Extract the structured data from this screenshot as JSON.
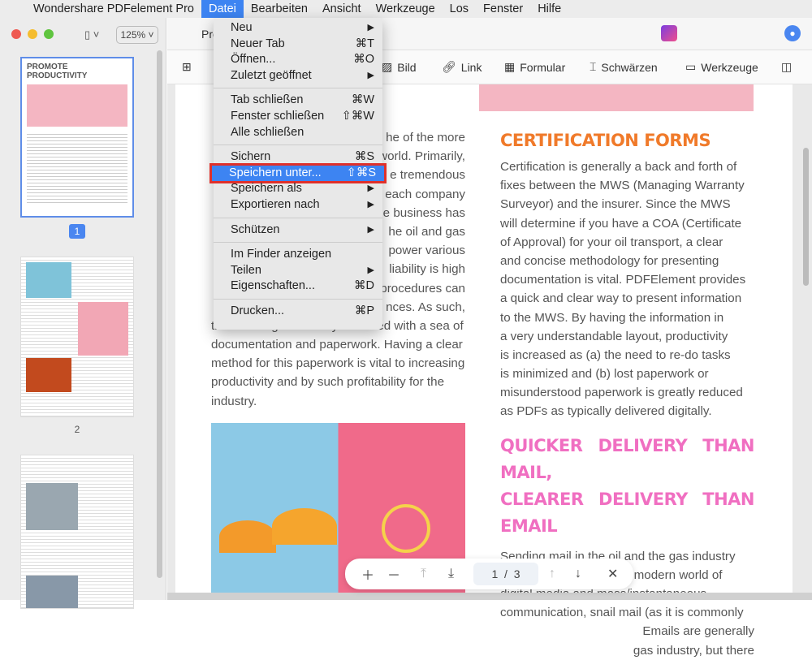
{
  "menubar": {
    "app": "Wondershare PDFelement Pro",
    "items": [
      "Datei",
      "Bearbeiten",
      "Ansicht",
      "Werkzeuge",
      "Los",
      "Fenster",
      "Hilfe"
    ]
  },
  "window": {
    "zoom": "125%",
    "tab": "Pro"
  },
  "toolbar": {
    "items": [
      "Bild",
      "Link",
      "Formular",
      "Schwärzen",
      "Werkzeuge"
    ]
  },
  "sidebar": {
    "thumb1_title": "PROMOTE PRODUCTIVITY",
    "pages": [
      "1",
      "2"
    ]
  },
  "file_menu": {
    "groups": [
      [
        {
          "label": "Neu",
          "shortcut": "▶"
        },
        {
          "label": "Neuer Tab",
          "shortcut": "⌘T"
        },
        {
          "label": "Öffnen...",
          "shortcut": "⌘O"
        },
        {
          "label": "Zuletzt geöffnet",
          "shortcut": "▶"
        }
      ],
      [
        {
          "label": "Tab schließen",
          "shortcut": "⌘W"
        },
        {
          "label": "Fenster schließen",
          "shortcut": "⇧⌘W"
        },
        {
          "label": "Alle schließen",
          "shortcut": ""
        }
      ],
      [
        {
          "label": "Sichern",
          "shortcut": "⌘S"
        },
        {
          "label": "Speichern unter...",
          "shortcut": "⇧⌘S"
        },
        {
          "label": "Speichern als",
          "shortcut": "▶"
        },
        {
          "label": "Exportieren nach",
          "shortcut": "▶"
        }
      ],
      [
        {
          "label": "Schützen",
          "shortcut": "▶"
        }
      ],
      [
        {
          "label": "Im Finder anzeigen",
          "shortcut": ""
        },
        {
          "label": "Teilen",
          "shortcut": "▶"
        },
        {
          "label": "Eigenschaften...",
          "shortcut": "⌘D"
        }
      ],
      [
        {
          "label": "Drucken...",
          "shortcut": "⌘P"
        }
      ]
    ],
    "highlighted": "Speichern unter..."
  },
  "document": {
    "left_col_partial": [
      "he of the more",
      "world. Primarily,",
      "e tremendous",
      "each company",
      "e business has",
      "he oil and gas",
      "power various",
      "liability is high",
      "procedures can",
      "nces. As such,"
    ],
    "left_col": [
      "the oil and gas industry is littered with a sea of",
      "documentation and paperwork. Having a clear",
      "method for this paperwork is vital to increasing",
      "productivity and by such profitability for the",
      "industry."
    ],
    "heading1": "CERTIFICATION FORMS",
    "right_col1": [
      "Certification is generally a back and forth of",
      "fixes between the MWS (Managing Warranty",
      "Surveyor) and the insurer. Since the MWS",
      "will determine if you have a COA (Certificate",
      "of Approval) for your oil transport, a clear",
      "and concise methodology for presenting",
      "documentation is vital. PDFElement provides",
      "a quick and clear way to present information",
      "to the MWS. By having the information in",
      "a very understandable layout, productivity",
      "is increased as (a) the need to re-do tasks",
      "is minimized and (b) lost paperwork or",
      "misunderstood paperwork is greatly reduced",
      "as PDFs as typically delivered digitally."
    ],
    "heading2": [
      "QUICKER DELIVERY THAN MAIL,",
      "CLEARER DELIVERY THAN EMAIL"
    ],
    "right_col2": [
      "Sending mail in the oil and the gas industry",
      "is a bit superfluous. In a modern world of",
      "digital media and mass/instantaneous",
      "communication, snail mail (as it is commonly",
      "Emails are generally",
      "gas industry, but there"
    ]
  },
  "page_nav": {
    "current": "1",
    "separator": "/",
    "total": "3"
  }
}
